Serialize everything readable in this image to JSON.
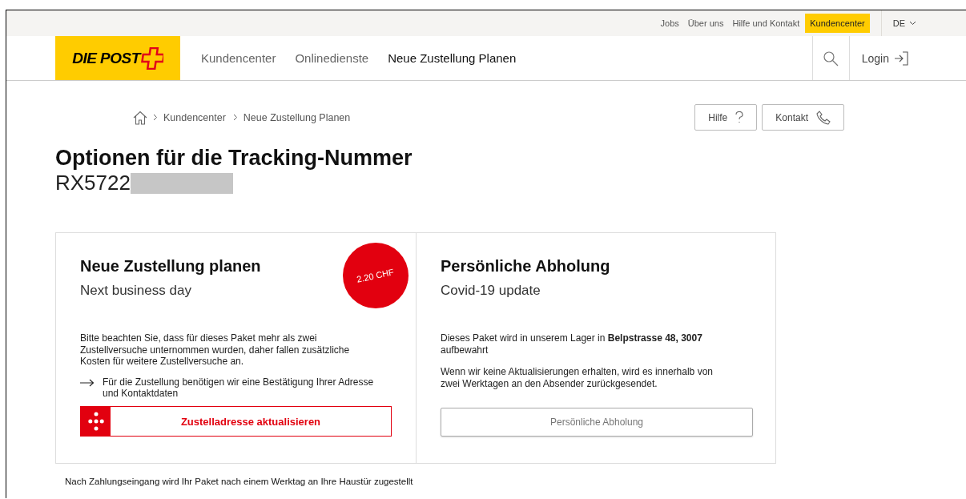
{
  "top_links": [
    {
      "label": "Jobs",
      "selected": false
    },
    {
      "label": "Über uns",
      "selected": false
    },
    {
      "label": "Hilfe und Kontakt",
      "selected": false
    },
    {
      "label": "Kundencenter",
      "selected": true
    }
  ],
  "language": "DE",
  "logo": "DIE POST",
  "nav": [
    {
      "label": "Kundencenter",
      "selected": false
    },
    {
      "label": "Onlinedienste",
      "selected": false
    },
    {
      "label": "Neue Zustellung Planen",
      "selected": true
    }
  ],
  "login": "Login",
  "breadcrumb": [
    "Kundencenter",
    "Neue Zustellung Planen"
  ],
  "help_buttons": [
    {
      "label": "Hilfe",
      "kind": "help"
    },
    {
      "label": "Kontakt",
      "kind": "phone"
    }
  ],
  "title": "Optionen für die Tracking-Nummer",
  "tracking_number": "RX5722",
  "cards": [
    {
      "title": "Neue Zustellung planen",
      "subtitle": "Next business day",
      "badge": "2.20 CHF",
      "paragraphs": [
        "Bitte beachten Sie, dass für dieses Paket mehr als zwei Zustellversuche unternommen wurden, daher fallen zusätzliche Kosten für weitere Zustellversuche an."
      ],
      "note": "Für die Zustellung benötigen wir eine Bestätigung Ihrer Adresse und Kontaktdaten",
      "button": {
        "label": "Zustelladresse aktualisieren",
        "kind": "primary"
      }
    },
    {
      "title": "Persönliche Abholung",
      "subtitle": "Covid-19 update",
      "paragraphs": [
        "Dieses Paket wird in unserem Lager in **Belpstrasse 48, 3007** aufbewahrt",
        "Wenn wir keine Aktualisierungen erhalten, wird es innerhalb von zwei Werktagen an den Absender zurückgesendet."
      ],
      "button": {
        "label": "Persönliche Abholung",
        "kind": "secondary"
      }
    }
  ],
  "footer_note": "Nach Zahlungseingang wird Ihr Paket nach einem Werktag an Ihre Haustür zugestellt"
}
